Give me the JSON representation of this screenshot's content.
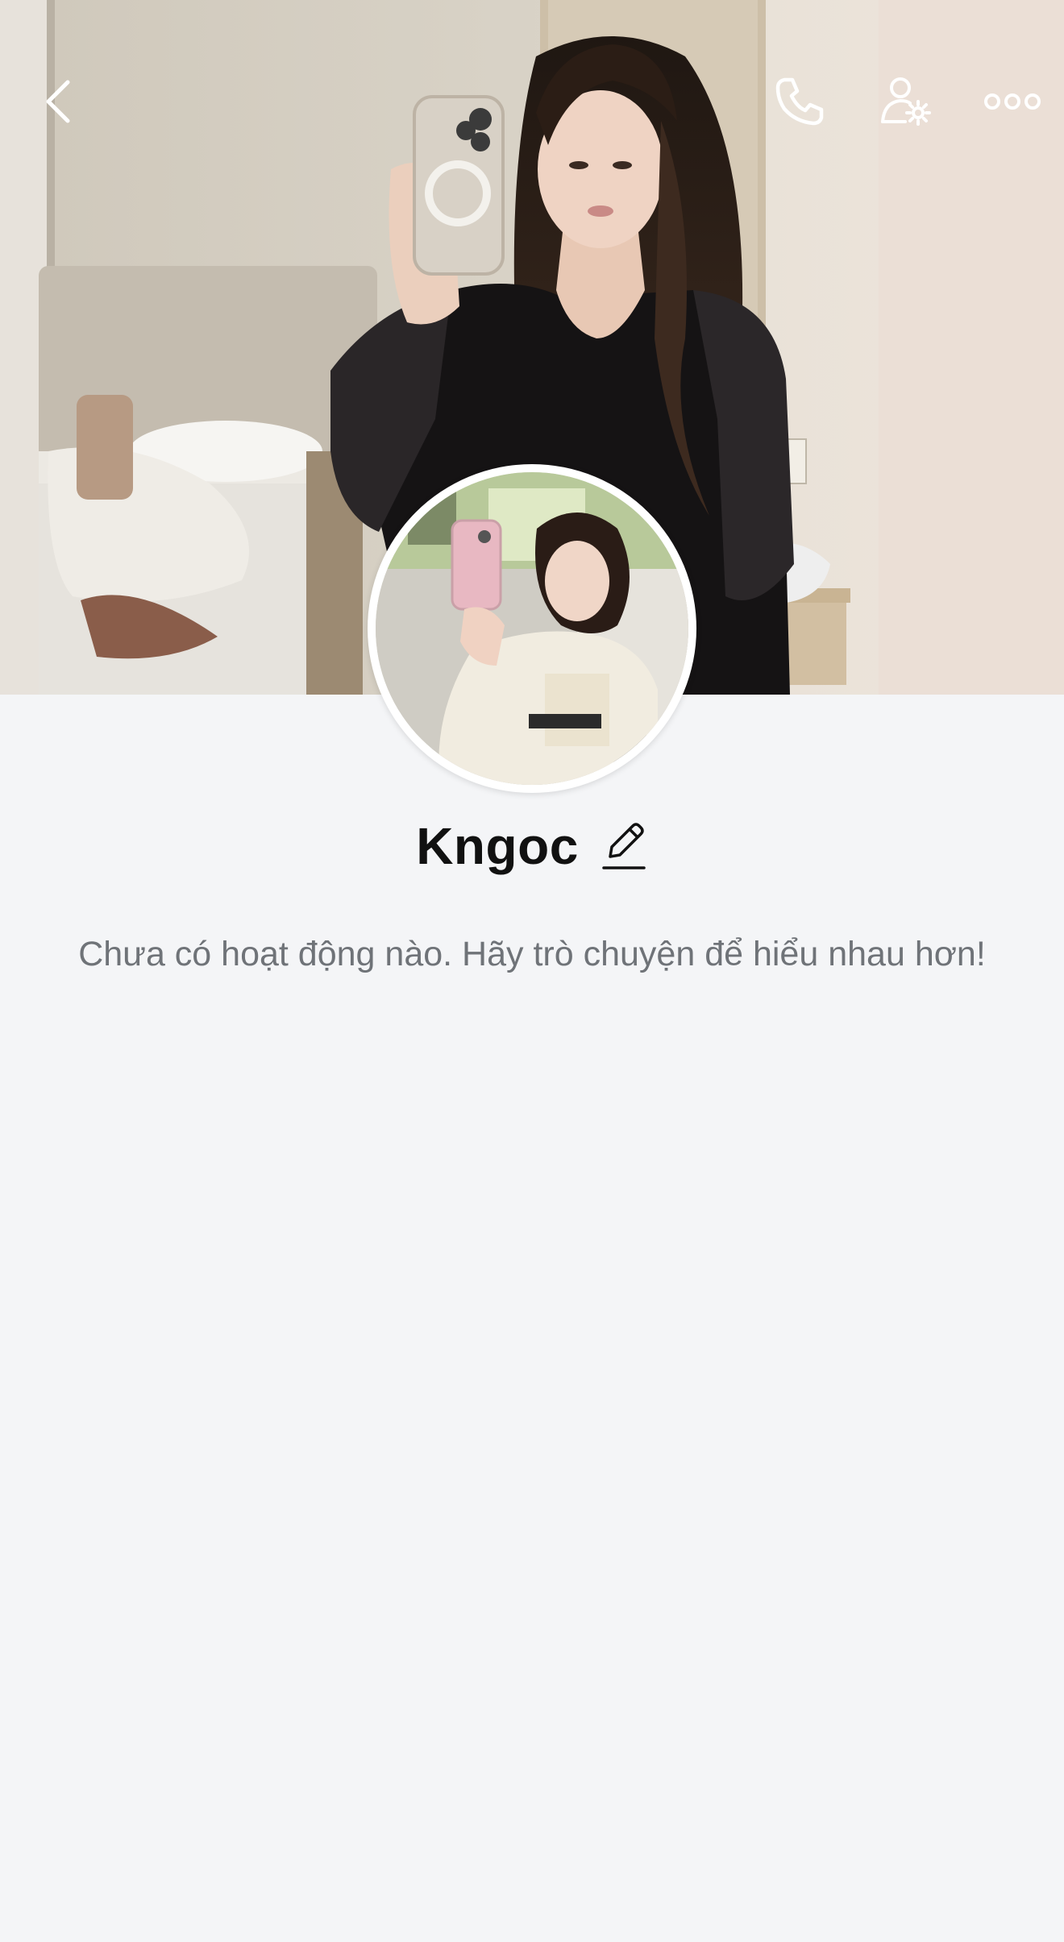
{
  "header": {
    "back_icon": "chevron-left-icon",
    "call_icon": "phone-icon",
    "settings_icon": "user-settings-icon",
    "more_icon": "more-horizontal-icon"
  },
  "cover": {
    "description_icon": "cover-photo"
  },
  "profile": {
    "name": "Kngoc",
    "edit_icon": "pencil-icon"
  },
  "activity": {
    "empty_message": "Chưa có hoạt động nào. Hãy trò chuyện để hiểu nhau hơn!"
  },
  "colors": {
    "background": "#f4f5f7",
    "name_text": "#111111",
    "muted_text": "#6f7378",
    "icon_light": "#ffffff"
  }
}
